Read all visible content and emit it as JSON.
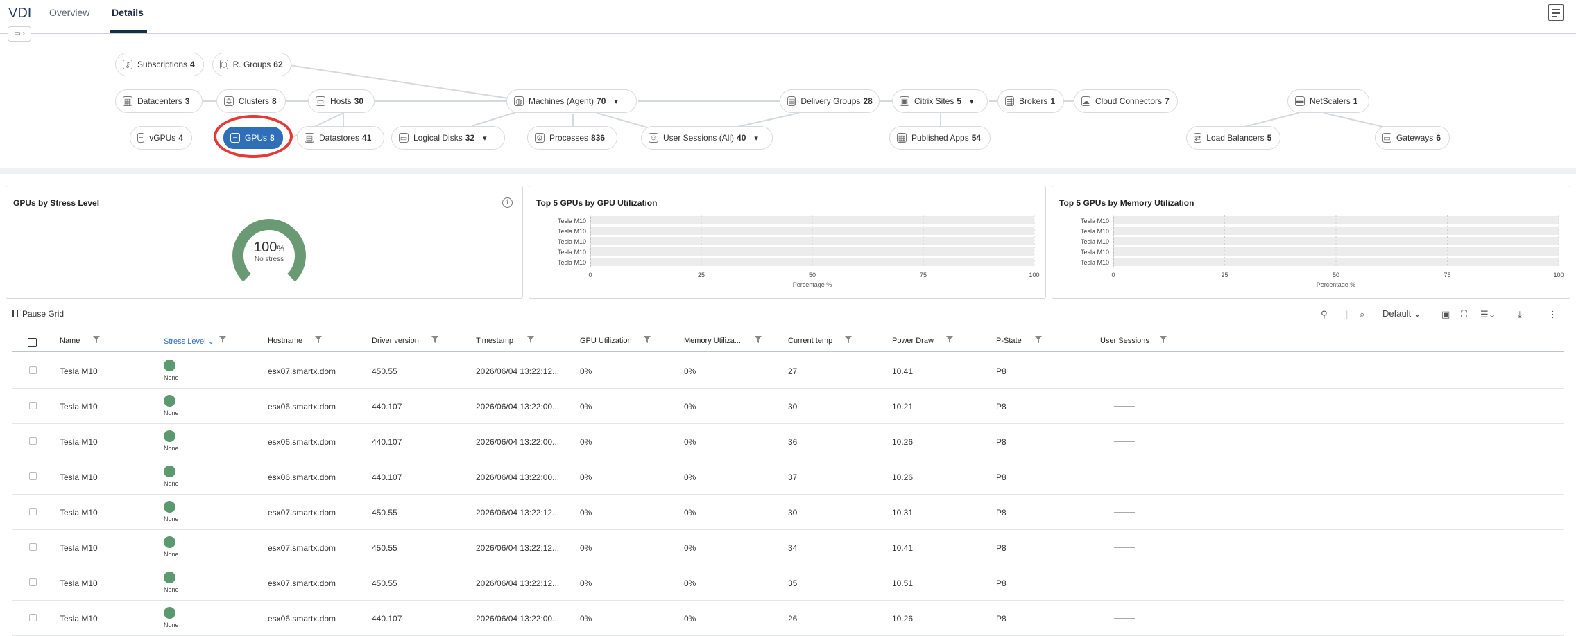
{
  "app": {
    "title": "VDI"
  },
  "tabs": [
    {
      "label": "Overview"
    },
    {
      "label": "Details"
    }
  ],
  "topology": {
    "subscriptions": {
      "label": "Subscriptions",
      "count": "4"
    },
    "r_groups": {
      "label": "R. Groups",
      "count": "62"
    },
    "datacenters": {
      "label": "Datacenters",
      "count": "3"
    },
    "clusters": {
      "label": "Clusters",
      "count": "8"
    },
    "hosts": {
      "label": "Hosts",
      "count": "30"
    },
    "machines": {
      "label": "Machines (Agent)",
      "count": "70"
    },
    "delivery_groups": {
      "label": "Delivery Groups",
      "count": "28"
    },
    "citrix_sites": {
      "label": "Citrix Sites",
      "count": "5"
    },
    "brokers": {
      "label": "Brokers",
      "count": "1"
    },
    "cloud_connectors": {
      "label": "Cloud Connectors",
      "count": "7"
    },
    "netscalers": {
      "label": "NetScalers",
      "count": "1"
    },
    "vgpus": {
      "label": "vGPUs",
      "count": "4"
    },
    "gpus": {
      "label": "GPUs",
      "count": "8"
    },
    "datastores": {
      "label": "Datastores",
      "count": "41"
    },
    "logical_disks": {
      "label": "Logical Disks",
      "count": "32"
    },
    "processes": {
      "label": "Processes",
      "count": "836"
    },
    "user_sessions": {
      "label": "User Sessions (All)",
      "count": "40"
    },
    "published_apps": {
      "label": "Published Apps",
      "count": "54"
    },
    "load_balancers": {
      "label": "Load Balancers",
      "count": "5"
    },
    "gateways": {
      "label": "Gateways",
      "count": "6"
    }
  },
  "cards": {
    "stress": {
      "title": "GPUs by Stress Level",
      "value": "100",
      "unit": "%",
      "sub": "No stress",
      "fraction": 1.0,
      "color": "#6a9a74"
    },
    "gpu_util": {
      "title": "Top 5 GPUs by GPU Utilization"
    },
    "mem_util": {
      "title": "Top 5 GPUs by Memory Utilization"
    }
  },
  "chart_data": [
    {
      "type": "bar",
      "title": "Top 5 GPUs by GPU Utilization",
      "categories": [
        "Tesla M10",
        "Tesla M10",
        "Tesla M10",
        "Tesla M10",
        "Tesla M10"
      ],
      "values": [
        0,
        0,
        0,
        0,
        0
      ],
      "xlabel": "Percentage %",
      "xlim": [
        0,
        100
      ],
      "ticks": [
        "0",
        "25",
        "50",
        "75",
        "100"
      ]
    },
    {
      "type": "bar",
      "title": "Top 5 GPUs by Memory Utilization",
      "categories": [
        "Tesla M10",
        "Tesla M10",
        "Tesla M10",
        "Tesla M10",
        "Tesla M10"
      ],
      "values": [
        0,
        0,
        0,
        0,
        0
      ],
      "xlabel": "Percentage %",
      "xlim": [
        0,
        100
      ],
      "ticks": [
        "0",
        "25",
        "50",
        "75",
        "100"
      ]
    }
  ],
  "grid": {
    "pause_label": "Pause Grid",
    "view_label": "Default",
    "columns": [
      "Name",
      "Stress Level",
      "Hostname",
      "Driver version",
      "Timestamp",
      "GPU Utilization",
      "Memory Utiliza...",
      "Current temp",
      "Power Draw",
      "P-State",
      "User Sessions"
    ],
    "rows": [
      {
        "name": "Tesla M10",
        "stress": "None",
        "host": "esx07.smartx.dom",
        "driver": "450.55",
        "ts": "2026/06/04 13:22:12...",
        "gpu": "0%",
        "mem": "0%",
        "temp": "27",
        "power": "10.41",
        "pstate": "P8"
      },
      {
        "name": "Tesla M10",
        "stress": "None",
        "host": "esx06.smartx.dom",
        "driver": "440.107",
        "ts": "2026/06/04 13:22:00...",
        "gpu": "0%",
        "mem": "0%",
        "temp": "30",
        "power": "10.21",
        "pstate": "P8"
      },
      {
        "name": "Tesla M10",
        "stress": "None",
        "host": "esx06.smartx.dom",
        "driver": "440.107",
        "ts": "2026/06/04 13:22:00...",
        "gpu": "0%",
        "mem": "0%",
        "temp": "36",
        "power": "10.26",
        "pstate": "P8"
      },
      {
        "name": "Tesla M10",
        "stress": "None",
        "host": "esx06.smartx.dom",
        "driver": "440.107",
        "ts": "2026/06/04 13:22:00...",
        "gpu": "0%",
        "mem": "0%",
        "temp": "37",
        "power": "10.26",
        "pstate": "P8"
      },
      {
        "name": "Tesla M10",
        "stress": "None",
        "host": "esx07.smartx.dom",
        "driver": "450.55",
        "ts": "2026/06/04 13:22:12...",
        "gpu": "0%",
        "mem": "0%",
        "temp": "30",
        "power": "10.31",
        "pstate": "P8"
      },
      {
        "name": "Tesla M10",
        "stress": "None",
        "host": "esx07.smartx.dom",
        "driver": "450.55",
        "ts": "2026/06/04 13:22:12...",
        "gpu": "0%",
        "mem": "0%",
        "temp": "34",
        "power": "10.41",
        "pstate": "P8"
      },
      {
        "name": "Tesla M10",
        "stress": "None",
        "host": "esx07.smartx.dom",
        "driver": "450.55",
        "ts": "2026/06/04 13:22:12...",
        "gpu": "0%",
        "mem": "0%",
        "temp": "35",
        "power": "10.51",
        "pstate": "P8"
      },
      {
        "name": "Tesla M10",
        "stress": "None",
        "host": "esx06.smartx.dom",
        "driver": "440.107",
        "ts": "2026/06/04 13:22:00...",
        "gpu": "0%",
        "mem": "0%",
        "temp": "26",
        "power": "10.26",
        "pstate": "P8"
      }
    ]
  }
}
